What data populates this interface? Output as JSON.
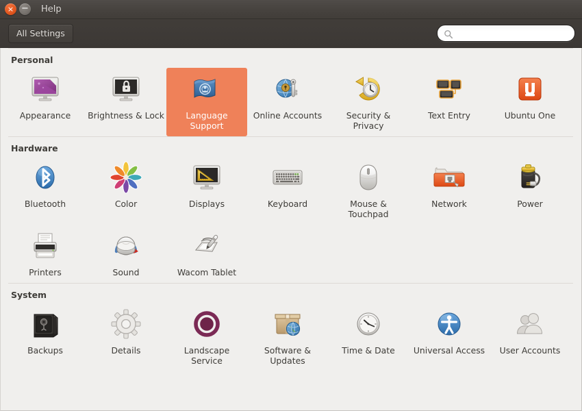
{
  "window": {
    "title": "Help",
    "close_glyph": "×",
    "minimize_glyph": "−",
    "close_icon": "close-icon",
    "minimize_icon": "minimize-icon"
  },
  "toolbar": {
    "all_settings_label": "All Settings",
    "search_placeholder": "",
    "search_value": "",
    "search_icon": "search-icon"
  },
  "accent_color": "#ef8159",
  "sections": [
    {
      "title": "Personal",
      "items": [
        {
          "label": "Appearance",
          "icon": "appearance-icon",
          "selected": false
        },
        {
          "label": "Brightness & Lock",
          "icon": "brightness-lock-icon",
          "selected": false
        },
        {
          "label": "Language Support",
          "icon": "language-support-icon",
          "selected": true
        },
        {
          "label": "Online Accounts",
          "icon": "online-accounts-icon",
          "selected": false
        },
        {
          "label": "Security & Privacy",
          "icon": "security-privacy-icon",
          "selected": false
        },
        {
          "label": "Text Entry",
          "icon": "text-entry-icon",
          "selected": false
        },
        {
          "label": "Ubuntu One",
          "icon": "ubuntu-one-icon",
          "selected": false
        }
      ]
    },
    {
      "title": "Hardware",
      "items": [
        {
          "label": "Bluetooth",
          "icon": "bluetooth-icon",
          "selected": false
        },
        {
          "label": "Color",
          "icon": "color-icon",
          "selected": false
        },
        {
          "label": "Displays",
          "icon": "displays-icon",
          "selected": false
        },
        {
          "label": "Keyboard",
          "icon": "keyboard-icon",
          "selected": false
        },
        {
          "label": "Mouse & Touchpad",
          "icon": "mouse-touchpad-icon",
          "selected": false
        },
        {
          "label": "Network",
          "icon": "network-icon",
          "selected": false
        },
        {
          "label": "Power",
          "icon": "power-icon",
          "selected": false
        },
        {
          "label": "Printers",
          "icon": "printers-icon",
          "selected": false
        },
        {
          "label": "Sound",
          "icon": "sound-icon",
          "selected": false
        },
        {
          "label": "Wacom Tablet",
          "icon": "wacom-tablet-icon",
          "selected": false
        }
      ]
    },
    {
      "title": "System",
      "items": [
        {
          "label": "Backups",
          "icon": "backups-icon",
          "selected": false
        },
        {
          "label": "Details",
          "icon": "details-icon",
          "selected": false
        },
        {
          "label": "Landscape Service",
          "icon": "landscape-service-icon",
          "selected": false
        },
        {
          "label": "Software & Updates",
          "icon": "software-updates-icon",
          "selected": false
        },
        {
          "label": "Time & Date",
          "icon": "time-date-icon",
          "selected": false
        },
        {
          "label": "Universal Access",
          "icon": "universal-access-icon",
          "selected": false
        },
        {
          "label": "User Accounts",
          "icon": "user-accounts-icon",
          "selected": false
        }
      ]
    }
  ]
}
